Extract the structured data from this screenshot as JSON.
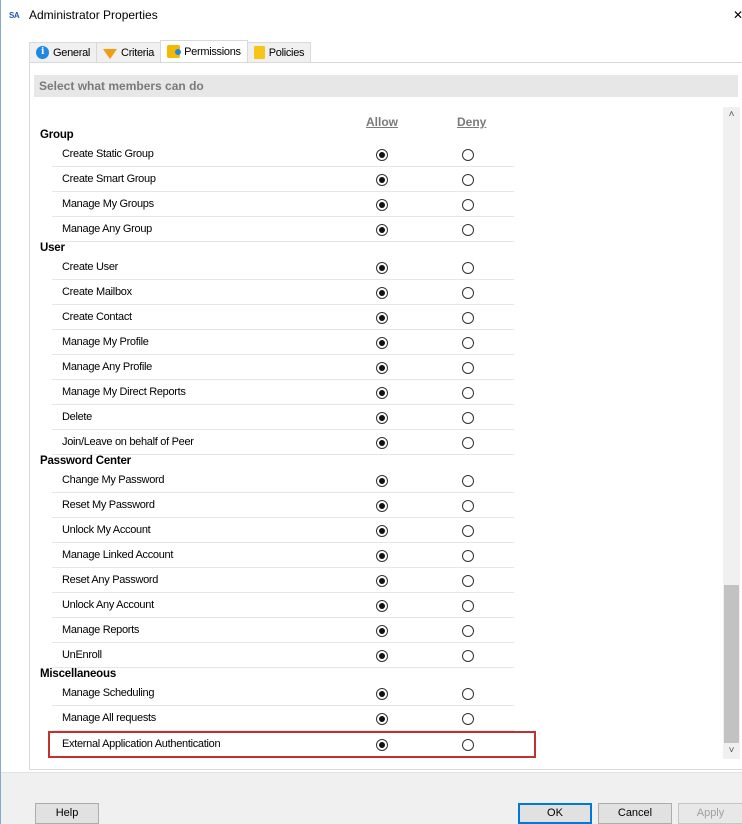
{
  "window": {
    "title": "Administrator Properties",
    "app_icon_text": "SA",
    "close_glyph": "✕"
  },
  "tabs": [
    {
      "label": "General",
      "icon": "info-icon",
      "active": false
    },
    {
      "label": "Criteria",
      "icon": "filter-icon",
      "active": false
    },
    {
      "label": "Permissions",
      "icon": "permissions-icon",
      "active": true
    },
    {
      "label": "Policies",
      "icon": "policies-icon",
      "active": false
    }
  ],
  "banner": "Select what members can do",
  "columns": {
    "allow": "Allow",
    "deny": "Deny"
  },
  "sections": [
    {
      "title": "Group",
      "items": [
        {
          "label": "Create Static Group",
          "value": "allow"
        },
        {
          "label": "Create Smart Group",
          "value": "allow"
        },
        {
          "label": "Manage My Groups",
          "value": "allow"
        },
        {
          "label": "Manage Any Group",
          "value": "allow"
        }
      ]
    },
    {
      "title": "User",
      "items": [
        {
          "label": "Create User",
          "value": "allow"
        },
        {
          "label": "Create Mailbox",
          "value": "allow"
        },
        {
          "label": "Create Contact",
          "value": "allow"
        },
        {
          "label": "Manage My Profile",
          "value": "allow"
        },
        {
          "label": "Manage Any Profile",
          "value": "allow"
        },
        {
          "label": "Manage My Direct Reports",
          "value": "allow"
        },
        {
          "label": "Delete",
          "value": "allow"
        },
        {
          "label": "Join/Leave on behalf of Peer",
          "value": "allow"
        }
      ]
    },
    {
      "title": "Password Center",
      "items": [
        {
          "label": "Change My Password",
          "value": "allow"
        },
        {
          "label": "Reset My Password",
          "value": "allow"
        },
        {
          "label": "Unlock My Account",
          "value": "allow"
        },
        {
          "label": "Manage Linked Account",
          "value": "allow"
        },
        {
          "label": "Reset Any Password",
          "value": "allow"
        },
        {
          "label": "Unlock Any Account",
          "value": "allow"
        },
        {
          "label": "Manage Reports",
          "value": "allow"
        },
        {
          "label": "UnEnroll",
          "value": "allow"
        }
      ]
    },
    {
      "title": "Miscellaneous",
      "items": [
        {
          "label": "Manage Scheduling",
          "value": "allow"
        },
        {
          "label": "Manage All requests",
          "value": "allow"
        },
        {
          "label": "External Application Authentication",
          "value": "allow",
          "highlighted": true
        }
      ]
    }
  ],
  "buttons": {
    "help": "Help",
    "ok": "OK",
    "cancel": "Cancel",
    "apply": "Apply"
  },
  "colors": {
    "highlight_border": "#c23030",
    "default_button_border": "#0078d7"
  }
}
